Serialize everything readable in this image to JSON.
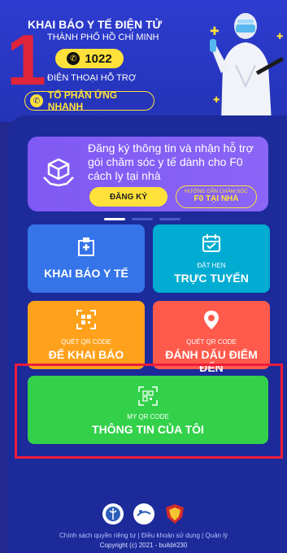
{
  "header": {
    "title": "KHAI BÁO Y TẾ ĐIỆN TỬ",
    "subtitle": "THÀNH PHỐ HỒ CHÍ MINH",
    "big_number": "1",
    "hotline": "1022",
    "hotline_label": "ĐIỆN THOẠI HỖ TRỢ",
    "rapid_response": "TỔ PHẢN ỨNG NHANH"
  },
  "register_card": {
    "text": "Đăng ký thông tin và nhận hỗ trợ gói chăm sóc y tế dành cho F0 cách ly tại nhà",
    "button": "ĐĂNG KÝ",
    "guide_line1": "HƯỚNG DẪN CHĂM SÓC",
    "guide_line2": "F0 TẠI NHÀ"
  },
  "tiles": {
    "health_declaration": {
      "label": "KHAI BÁO Y TẾ"
    },
    "appointment": {
      "small": "ĐẶT HẸN",
      "big": "TRỰC TUYẾN"
    },
    "scan_declare": {
      "small": "QUÉT QR CODE",
      "big": "ĐỂ KHAI BÁO"
    },
    "scan_location": {
      "small": "QUÉT QR CODE",
      "big": "ĐÁNH DẤU ĐIỂM ĐẾN"
    },
    "my_qr": {
      "small": "MY QR CODE",
      "big": "THÔNG TIN CỦA TÔI"
    }
  },
  "footer": {
    "links": "Chính sách quyền riêng tư | Điều khoản sử dụng | Quản lý",
    "copyright": "Copyright (c) 2021 - build#230"
  },
  "colors": {
    "background": "#222a8f",
    "register": "#8a65f6",
    "tile_blue": "#3574e9",
    "tile_cyan": "#00acd1",
    "tile_orange": "#ffa11b",
    "tile_red": "#ff5a4b",
    "tile_green": "#33d14a",
    "highlight": "#ef1b3d",
    "accent_yellow": "#ffe13a"
  }
}
